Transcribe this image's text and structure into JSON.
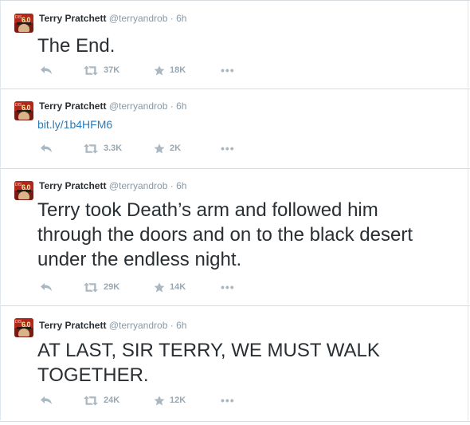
{
  "tweets": [
    {
      "author": "Terry Pratchett",
      "handle": "@terryandrob",
      "sep": "·",
      "time": "6h",
      "avatar_badge": "6.0",
      "text": "The End.",
      "text_style": "big",
      "retweets": "37K",
      "favorites": "18K"
    },
    {
      "author": "Terry Pratchett",
      "handle": "@terryandrob",
      "sep": "·",
      "time": "6h",
      "avatar_badge": "6.0",
      "text": "bit.ly/1b4HFM6",
      "text_style": "link",
      "retweets": "3.3K",
      "favorites": "2K"
    },
    {
      "author": "Terry Pratchett",
      "handle": "@terryandrob",
      "sep": "·",
      "time": "6h",
      "avatar_badge": "6.0",
      "text": "Terry took Death’s arm and followed him through the doors and on to the black desert under the endless night.",
      "text_style": "big",
      "retweets": "29K",
      "favorites": "14K"
    },
    {
      "author": "Terry Pratchett",
      "handle": "@terryandrob",
      "sep": "·",
      "time": "6h",
      "avatar_badge": "6.0",
      "text": "AT LAST, SIR TERRY, WE MUST WALK TOGETHER.",
      "text_style": "big",
      "retweets": "24K",
      "favorites": "12K"
    }
  ],
  "more_label": "•••",
  "icons": {
    "reply": "reply-icon",
    "retweet": "retweet-icon",
    "favorite": "star-icon",
    "more": "more-icon"
  },
  "colors": {
    "text": "#292f33",
    "meta": "#8899a6",
    "link": "#2b7bb9",
    "action": "#aab8c2"
  }
}
